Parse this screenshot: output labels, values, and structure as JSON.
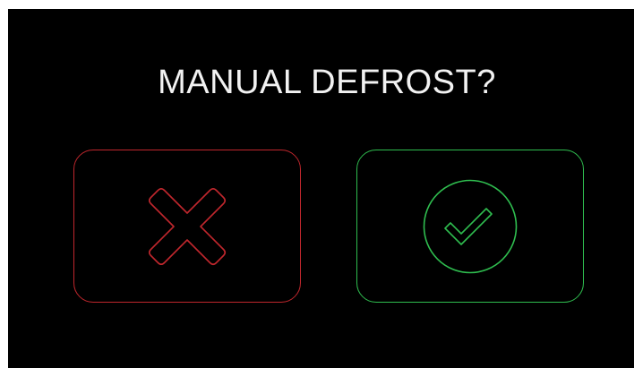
{
  "dialog": {
    "title": "MANUAL DEFROST?"
  },
  "buttons": {
    "cancel": {
      "icon": "close-icon",
      "color": "#c0272d"
    },
    "confirm": {
      "icon": "check-circle-icon",
      "color": "#2fbd4f"
    }
  },
  "colors": {
    "background": "#000000",
    "title_text": "#f2f2f2"
  }
}
